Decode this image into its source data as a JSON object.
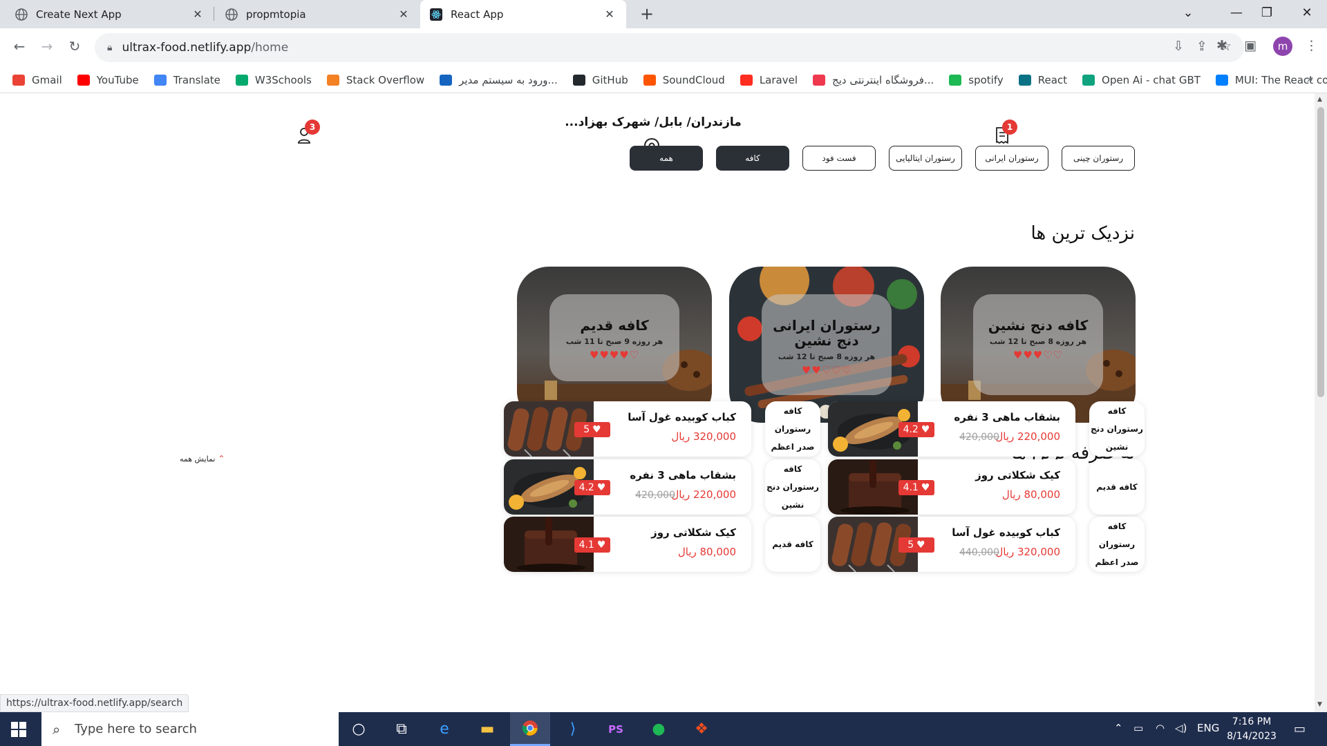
{
  "browser": {
    "tabs": [
      {
        "title": "Create Next App",
        "icon": "globe-icon"
      },
      {
        "title": "propmtopia",
        "icon": "globe-icon"
      },
      {
        "title": "React App",
        "icon": "react-icon"
      }
    ],
    "url_host": "ultrax-food.netlify.app",
    "url_path": "/home",
    "profile_initial": "m",
    "bookmarks": [
      {
        "label": "Gmail",
        "color": "#ea4335",
        "icon": "gmail-icon"
      },
      {
        "label": "YouTube",
        "color": "#ff0000",
        "icon": "youtube-icon"
      },
      {
        "label": "Translate",
        "color": "#4285f4",
        "icon": "translate-icon"
      },
      {
        "label": "W3Schools",
        "color": "#04aa6d",
        "icon": "w3schools-icon"
      },
      {
        "label": "Stack Overflow",
        "color": "#f48024",
        "icon": "stackoverflow-icon"
      },
      {
        "label": "ورود به سیستم مدیر...",
        "color": "#1565c0",
        "icon": "admin-icon"
      },
      {
        "label": "GitHub",
        "color": "#24292e",
        "icon": "github-icon"
      },
      {
        "label": "SoundCloud",
        "color": "#ff5500",
        "icon": "soundcloud-icon"
      },
      {
        "label": "Laravel",
        "color": "#ff2d20",
        "icon": "laravel-icon"
      },
      {
        "label": "فروشگاه اینترنتی دیج...",
        "color": "#ef394e",
        "icon": "digikala-icon"
      },
      {
        "label": "spotify",
        "color": "#1db954",
        "icon": "spotify-icon"
      },
      {
        "label": "React",
        "color": "#0b7285",
        "icon": "react-icon"
      },
      {
        "label": "Open Ai - chat GBT",
        "color": "#10a37f",
        "icon": "openai-icon"
      },
      {
        "label": "MUI: The React co...",
        "color": "#007fff",
        "icon": "mui-icon"
      }
    ],
    "status_url": "https://ultrax-food.netlify.app/search"
  },
  "header": {
    "address": "مازندران/ بابل/ شهرک بهزاد...",
    "orders_badge": "1",
    "user_badge": "3"
  },
  "categories": [
    {
      "label": "همه",
      "active": true
    },
    {
      "label": "کافه",
      "active": true
    },
    {
      "label": "فست فود",
      "active": false
    },
    {
      "label": "رستوران ایتالیایی",
      "active": false
    },
    {
      "label": "رستوران ایرانی",
      "active": false
    },
    {
      "label": "رستوران چینی",
      "active": false
    }
  ],
  "nearest": {
    "title": "نزدیک ترین ها",
    "cards": [
      {
        "name": "کافه دنج نشین",
        "hours": "هر روزه 8 صبح تا 12 شب",
        "hearts": "♡♡♥♥♥"
      },
      {
        "name": "رستوران ایرانی دنج نشین",
        "hours": "هر روزه 8 صبح تا 12 شب",
        "hearts": "♡♡♡♥♥"
      },
      {
        "name": "کافه قدیم",
        "hours": "هر روزه 9 صبح تا 11 شب",
        "hearts": "♡♥♥♥♥"
      }
    ]
  },
  "cheapest": {
    "title": "به صرفه ترین ها",
    "show_all": "نمایش همه",
    "items": [
      {
        "restaurant": "کافه رستوران دنج نشین",
        "title": "بشقاب ماهی 3 نفره",
        "price": "220,000 ریال",
        "old_price": "420,000",
        "rating": "4.2",
        "image": "fish"
      },
      {
        "restaurant": "کافه رستوران صدر اعظم",
        "title": "کباب کوبیده غول آسا",
        "price": "320,000 ریال",
        "old_price": "",
        "rating": "5",
        "image": "kebab"
      },
      {
        "restaurant": "کافه قدیم",
        "title": "کیک شکلاتی روز",
        "price": "80,000 ریال",
        "old_price": "",
        "rating": "4.1",
        "image": "cake"
      },
      {
        "restaurant": "کافه رستوران دنج نشین",
        "title": "بشقاب ماهی 3 نفره",
        "price": "220,000 ریال",
        "old_price": "420,000",
        "rating": "4.2",
        "image": "fish"
      },
      {
        "restaurant": "کافه رستوران صدر اعظم",
        "title": "کباب کوبیده غول آسا",
        "price": "320,000 ریال",
        "old_price": "440,000",
        "rating": "5",
        "image": "kebab"
      },
      {
        "restaurant": "کافه قدیم",
        "title": "کیک شکلاتی روز",
        "price": "80,000 ریال",
        "old_price": "",
        "rating": "4.1",
        "image": "cake"
      }
    ]
  },
  "taskbar": {
    "search_placeholder": "Type here to search",
    "lang": "ENG",
    "time": "7:16 PM",
    "date": "8/14/2023"
  }
}
